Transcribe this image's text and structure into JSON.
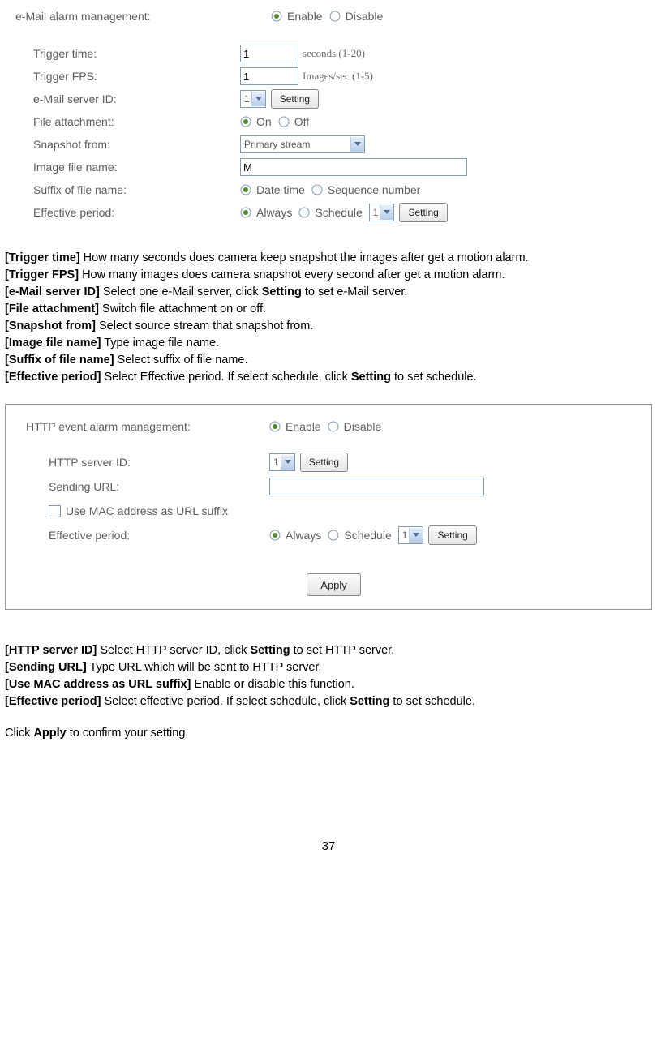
{
  "section1": {
    "heading": "e-Mail alarm management:",
    "radio_enable": "Enable",
    "radio_disable": "Disable",
    "rows": {
      "trigger_time": {
        "label": "Trigger time:",
        "value": "1",
        "hint": "seconds (1-20)"
      },
      "trigger_fps": {
        "label": "Trigger FPS:",
        "value": "1",
        "hint": "Images/sec (1-5)"
      },
      "server_id": {
        "label": "e-Mail server ID:",
        "value": "1",
        "button": "Setting"
      },
      "file_attach": {
        "label": "File attachment:",
        "on": "On",
        "off": "Off"
      },
      "snapshot": {
        "label": "Snapshot from:",
        "value": "Primary stream"
      },
      "filename": {
        "label": "Image file name:",
        "value": "M"
      },
      "suffix": {
        "label": "Suffix of file name:",
        "opt1": "Date time",
        "opt2": "Sequence number"
      },
      "effective": {
        "label": "Effective period:",
        "opt1": "Always",
        "opt2": "Schedule",
        "sel": "1",
        "button": "Setting"
      }
    }
  },
  "desc1": {
    "trig_time_l": "[Trigger time]",
    "trig_time_t": " How many seconds does camera keep snapshot the images after get a motion alarm.",
    "trig_fps_l": "[Trigger FPS]",
    "trig_fps_t": " How many images does camera snapshot every second after get a motion alarm.",
    "server_l": "[e-Mail server ID]",
    "server_t1": " Select one e-Mail server, click ",
    "server_b": "Setting",
    "server_t2": " to set e-Mail server.",
    "file_l": "[File attachment]",
    "file_t": " Switch file attachment on or off.",
    "snap_l": "[Snapshot from]",
    "snap_t": " Select source stream that snapshot from.",
    "name_l": "[Image file name]",
    "name_t": " Type image file name.",
    "suf_l": "[Suffix of file name]",
    "suf_t": " Select suffix of file name.",
    "eff_l": "[Effective period]",
    "eff_t1": " Select Effective period. If select schedule, click ",
    "eff_b": "Setting",
    "eff_t2": " to set schedule."
  },
  "section2": {
    "heading": "HTTP event alarm management:",
    "radio_enable": "Enable",
    "radio_disable": "Disable",
    "rows": {
      "server": {
        "label": "HTTP server ID:",
        "value": "1",
        "button": "Setting"
      },
      "url": {
        "label": "Sending URL:",
        "value": ""
      },
      "mac": {
        "label": "Use MAC address as URL suffix"
      },
      "effective": {
        "label": "Effective period:",
        "opt1": "Always",
        "opt2": "Schedule",
        "sel": "1",
        "button": "Setting"
      }
    },
    "apply": "Apply"
  },
  "desc2": {
    "srv_l": "[HTTP server ID]",
    "srv_t1": " Select HTTP server ID, click ",
    "srv_b": "Setting",
    "srv_t2": " to set HTTP server.",
    "url_l": "[Sending URL]",
    "url_t": " Type URL which will be sent to HTTP server.",
    "mac_l": "[Use MAC address as URL suffix]",
    "mac_t": " Enable or disable this function.",
    "eff_l": "[Effective period]",
    "eff_t1": " Select effective period. If select schedule, click ",
    "eff_b": "Setting",
    "eff_t2": " to set schedule.",
    "apply_t1": "Click ",
    "apply_b": "Apply",
    "apply_t2": " to confirm your setting."
  },
  "page": "37"
}
